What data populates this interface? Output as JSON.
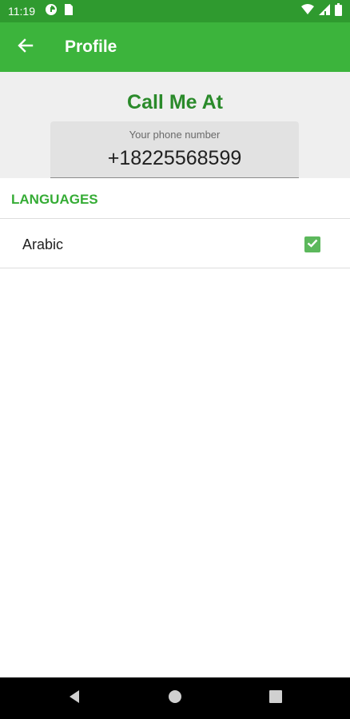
{
  "status_bar": {
    "time": "11:19",
    "left_icons": [
      "data-saver-icon",
      "sim-card-icon"
    ],
    "right_icons": [
      "wifi-icon",
      "cellular-signal-icon",
      "battery-icon"
    ]
  },
  "app_bar": {
    "title": "Profile",
    "back_icon": "arrow-back-icon"
  },
  "contact": {
    "title": "Call Me At",
    "phone_field": {
      "label": "Your phone number",
      "value": "+18225568599"
    }
  },
  "languages": {
    "header": "LANGUAGES",
    "items": [
      {
        "label": "Arabic",
        "checked": true
      }
    ]
  },
  "nav_bar": {
    "buttons": [
      "back-triangle-icon",
      "home-circle-icon",
      "recents-square-icon"
    ]
  },
  "colors": {
    "status_bar": "#2f9a2f",
    "app_bar": "#3cb43c",
    "title_green": "#2a8a2a",
    "section_green": "#35ac35",
    "checkbox_green": "#5cb85c",
    "header_bg": "#efefef",
    "field_bg": "#e2e2e2"
  }
}
